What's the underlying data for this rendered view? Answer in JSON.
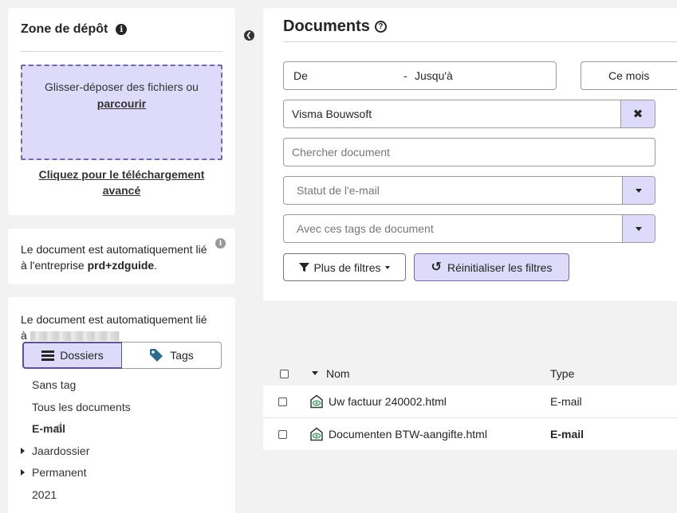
{
  "upload": {
    "title": "Zone de dépôt",
    "drop_text": "Glisser-déposer des fichiers ou",
    "browse_link": "parcourir",
    "advanced_line1": "Cliquez pour le téléchargement",
    "advanced_line2": "avancé"
  },
  "company_notice": {
    "text_line1": "Le document est automatiquement lié",
    "text_prefix": "à l'entreprise ",
    "company": "prd+zdguide",
    "text_suffix": "."
  },
  "folders": {
    "text_line1": "Le document est automatiquement lié",
    "text_prefix": "à",
    "tab_folders": "Dossiers",
    "tab_tags": "Tags",
    "items": [
      {
        "label": "Sans tag"
      },
      {
        "label": "Tous les documents"
      },
      {
        "label": "E-mail"
      },
      {
        "label": "Jaardossier"
      },
      {
        "label": "Permanent"
      },
      {
        "label": "2021"
      }
    ]
  },
  "documents": {
    "title": "Documents",
    "date_from": "De",
    "date_separator": "-",
    "date_to": "Jusqu'à",
    "period_button": "Ce mois",
    "company_value": "Visma Bouwsoft",
    "search_placeholder": "Chercher document",
    "status_placeholder": "Statut de l'e-mail",
    "tags_placeholder": "Avec ces tags de document",
    "more_filters": "Plus de filtres",
    "reset_filters": "Réinitialiser les filtres"
  },
  "table": {
    "col_name": "Nom",
    "col_type": "Type",
    "rows": [
      {
        "name": "Uw factuur 240002.html",
        "type": "E-mail"
      },
      {
        "name": "Documenten BTW-aangifte.html",
        "type": "E-mail"
      }
    ]
  },
  "colors": {
    "accent_bg": "#dedafa",
    "accent_border": "#7468a8",
    "tag_icon": "#2f6b8a"
  }
}
